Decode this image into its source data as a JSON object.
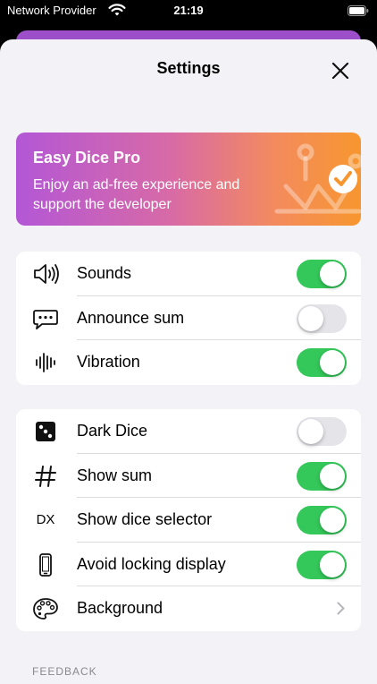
{
  "status_bar": {
    "carrier": "Network Provider",
    "time": "21:19"
  },
  "sheet": {
    "title": "Settings"
  },
  "promo": {
    "title": "Easy Dice Pro",
    "subtitle": "Enjoy an ad-free experience and support the developer"
  },
  "sound_group": [
    {
      "label": "Sounds",
      "icon": "speaker-icon",
      "on": true
    },
    {
      "label": "Announce sum",
      "icon": "speech-bubble-icon",
      "on": false
    },
    {
      "label": "Vibration",
      "icon": "waveform-icon",
      "on": true
    }
  ],
  "display_group": [
    {
      "label": "Dark Dice",
      "icon": "dice-icon",
      "on": false
    },
    {
      "label": "Show sum",
      "icon": "hash-icon",
      "on": true
    },
    {
      "label": "Show dice selector",
      "icon": "dx-icon",
      "icon_text": "DX",
      "on": true
    },
    {
      "label": "Avoid locking display",
      "icon": "phone-icon",
      "on": true
    },
    {
      "label": "Background",
      "icon": "palette-icon"
    }
  ],
  "section_footer": "FEEDBACK",
  "colors": {
    "toggle_on": "#34c759",
    "toggle_off": "#e4e4e9",
    "promo_start": "#b357d6",
    "promo_end": "#f7962f",
    "sheet_bg": "#f2f2f7"
  }
}
